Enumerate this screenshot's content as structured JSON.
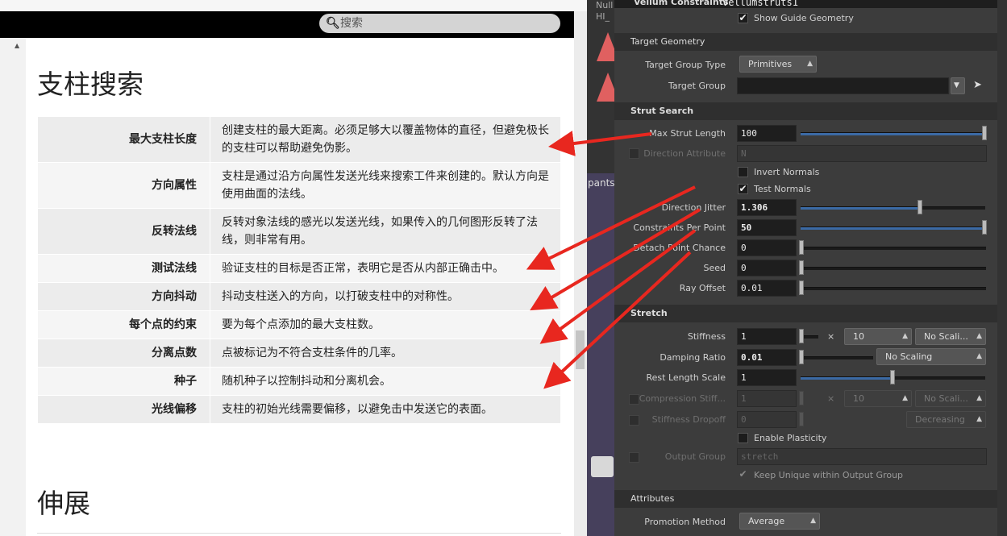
{
  "search": {
    "placeholder": "搜索",
    "icon": "search-icon"
  },
  "doc": {
    "title": "支柱搜索",
    "next_title": "伸展",
    "rows": [
      {
        "key": "最大支柱长度",
        "desc": "创建支柱的最大距离。必须足够大以覆盖物体的直径，但避免极长的支柱可以帮助避免伪影。"
      },
      {
        "key": "方向属性",
        "desc": "支柱是通过沿方向属性发送光线来搜索工件来创建的。默认方向是使用曲面的法线。"
      },
      {
        "key": "反转法线",
        "desc": "反转对象法线的感光以发送光线，如果传入的几何图形反转了法线，则非常有用。"
      },
      {
        "key": "测试法线",
        "desc": "验证支柱的目标是否正常，表明它是否从内部正确击中。"
      },
      {
        "key": "方向抖动",
        "desc": "抖动支柱送入的方向，以打破支柱中的对称性。"
      },
      {
        "key": "每个点的约束",
        "desc": "要为每个点添加的最大支柱数。"
      },
      {
        "key": "分离点数",
        "desc": "点被标记为不符合支柱条件的几率。"
      },
      {
        "key": "种子",
        "desc": "随机种子以控制抖动和分离机会。"
      },
      {
        "key": "光线偏移",
        "desc": "支柱的初始光线需要偏移，以避免击中发送它的表面。"
      }
    ]
  },
  "mid": {
    "null_label": "Null",
    "hi_label": "HI_",
    "pants_label": "pants"
  },
  "panel": {
    "title": "Vellum Constraints",
    "node_name": "vellumstruts1",
    "show_guide": "Show Guide Geometry",
    "target_geometry": {
      "header": "Target Geometry",
      "group_type_label": "Target Group Type",
      "group_type_value": "Primitives",
      "group_label": "Target Group",
      "group_value": ""
    },
    "strut_search": {
      "header": "Strut Search",
      "max_strut_length_label": "Max Strut Length",
      "max_strut_length_value": "100",
      "direction_attribute_label": "Direction Attribute",
      "direction_attribute_value": "N",
      "invert_normals": "Invert Normals",
      "test_normals": "Test Normals",
      "direction_jitter_label": "Direction Jitter",
      "direction_jitter_value": "1.306",
      "constraints_per_point_label": "Constraints Per Point",
      "constraints_per_point_value": "50",
      "detach_point_chance_label": "Detach Point Chance",
      "detach_point_chance_value": "0",
      "seed_label": "Seed",
      "seed_value": "0",
      "ray_offset_label": "Ray Offset",
      "ray_offset_value": "0.01"
    },
    "stretch": {
      "header": "Stretch",
      "stiffness_label": "Stiffness",
      "stiffness_value": "1",
      "stiffness_mult": "×",
      "stiffness_exp": "10",
      "stiffness_scaling": "No Scali...",
      "damping_label": "Damping Ratio",
      "damping_value": "0.01",
      "damping_scaling": "No Scaling",
      "rest_length_label": "Rest Length Scale",
      "rest_length_value": "1",
      "compression_label": "Compression Stiff...",
      "compression_value": "1",
      "compression_exp": "10",
      "compression_scaling": "No Scali...",
      "dropoff_label": "Stiffness Dropoff",
      "dropoff_value": "0",
      "dropoff_mode": "Decreasing",
      "plasticity": "Enable Plasticity",
      "output_group_label": "Output Group",
      "output_group_value": "stretch",
      "keep_unique": "Keep Unique within Output Group"
    },
    "attributes": {
      "header": "Attributes",
      "promotion_label": "Promotion Method",
      "promotion_value": "Average"
    }
  },
  "colors": {
    "arrow": "#e8271f",
    "slider_fill": "#3b6aa5",
    "alert_triangle": "#e06060"
  }
}
